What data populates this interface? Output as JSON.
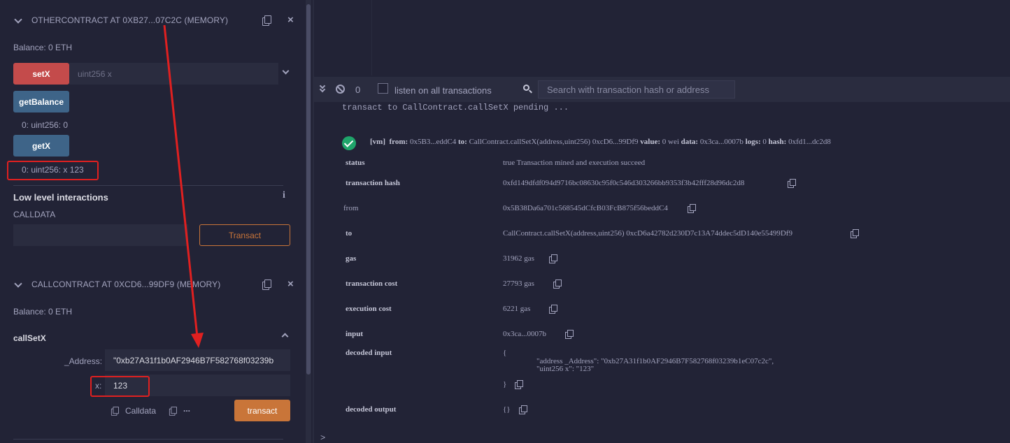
{
  "other_contract": {
    "title": "OTHERCONTRACT AT 0XB27...07C2C (MEMORY)",
    "balance": "Balance: 0 ETH",
    "setx_label": "setX",
    "setx_placeholder": "uint256 x",
    "getbalance_label": "getBalance",
    "getbalance_result": "0: uint256: 0",
    "getx_label": "getX",
    "getx_result": "0: uint256: x 123",
    "low_level_title": "Low level interactions",
    "calldata_label": "CALLDATA",
    "transact_label": "Transact",
    "close": "×"
  },
  "call_contract": {
    "title": "CALLCONTRACT AT 0XCD6...99DF9 (MEMORY)",
    "balance": "Balance: 0 ETH",
    "function_name": "callSetX",
    "address_label": "_Address:",
    "address_value": "\"0xb27A31f1b0AF2946B7F582768f03239b",
    "x_label": "x:",
    "x_value": "123",
    "calldata_label": "Calldata",
    "more": "...",
    "transact_label": "transact",
    "close": "×"
  },
  "terminal_bar": {
    "count": "0",
    "listen_label": "listen on all transactions",
    "search_placeholder": "Search with transaction hash or address"
  },
  "terminal": {
    "pending_line": "transact to CallContract.callSetX pending ...",
    "summary": {
      "vm": "[vm]",
      "from_key": "from:",
      "from_val": "0x5B3...eddC4",
      "to_key": "to:",
      "to_val": "CallContract.callSetX(address,uint256) 0xcD6...99Df9",
      "value_key": "value:",
      "value_val": "0 wei",
      "data_key": "data:",
      "data_val": "0x3ca...0007b",
      "logs_key": "logs:",
      "logs_val": "0",
      "hash_key": "hash:",
      "hash_val": "0xfd1...dc2d8"
    },
    "rows": {
      "status_key": "status",
      "status_val": "true Transaction mined and execution succeed",
      "txhash_key": "transaction hash",
      "txhash_val": "0xfd149dfdf094d9716bc08630c95f0c546d303266bb9353f3b42fff28d96dc2d8",
      "from_key": "from",
      "from_val": "0x5B38Da6a701c568545dCfcB03FcB875f56beddC4",
      "to_key": "to",
      "to_val": "CallContract.callSetX(address,uint256) 0xcD6a42782d230D7c13A74ddec5dD140e55499Df9",
      "gas_key": "gas",
      "gas_val": "31962 gas",
      "txcost_key": "transaction cost",
      "txcost_val": "27793 gas",
      "execcost_key": "execution cost",
      "execcost_val": "6221 gas",
      "input_key": "input",
      "input_val": "0x3ca...0007b",
      "decoded_input_key": "decoded input",
      "decoded_input_open": "{",
      "decoded_input_line1": "\"address _Address\": \"0xb27A31f1b0AF2946B7F582768f03239b1eC07c2c\",",
      "decoded_input_line2": "\"uint256 x\": \"123\"",
      "decoded_input_close": "}",
      "decoded_output_key": "decoded output",
      "decoded_output_val": "{}"
    },
    "prompt": ">"
  },
  "colors": {
    "background": "#222336",
    "panel": "#2a2c3f",
    "red_button": "#c44b4b",
    "blue_button": "#3e6488",
    "orange_button": "#c97539",
    "success_green": "#1fa56b",
    "annotation_red": "#e02020"
  },
  "icons": [
    "chevron-down-icon",
    "copy-icon",
    "close-icon",
    "info-icon",
    "chevron-up-icon",
    "double-chevron-down-icon",
    "block-icon",
    "search-icon",
    "check-circle-icon"
  ]
}
